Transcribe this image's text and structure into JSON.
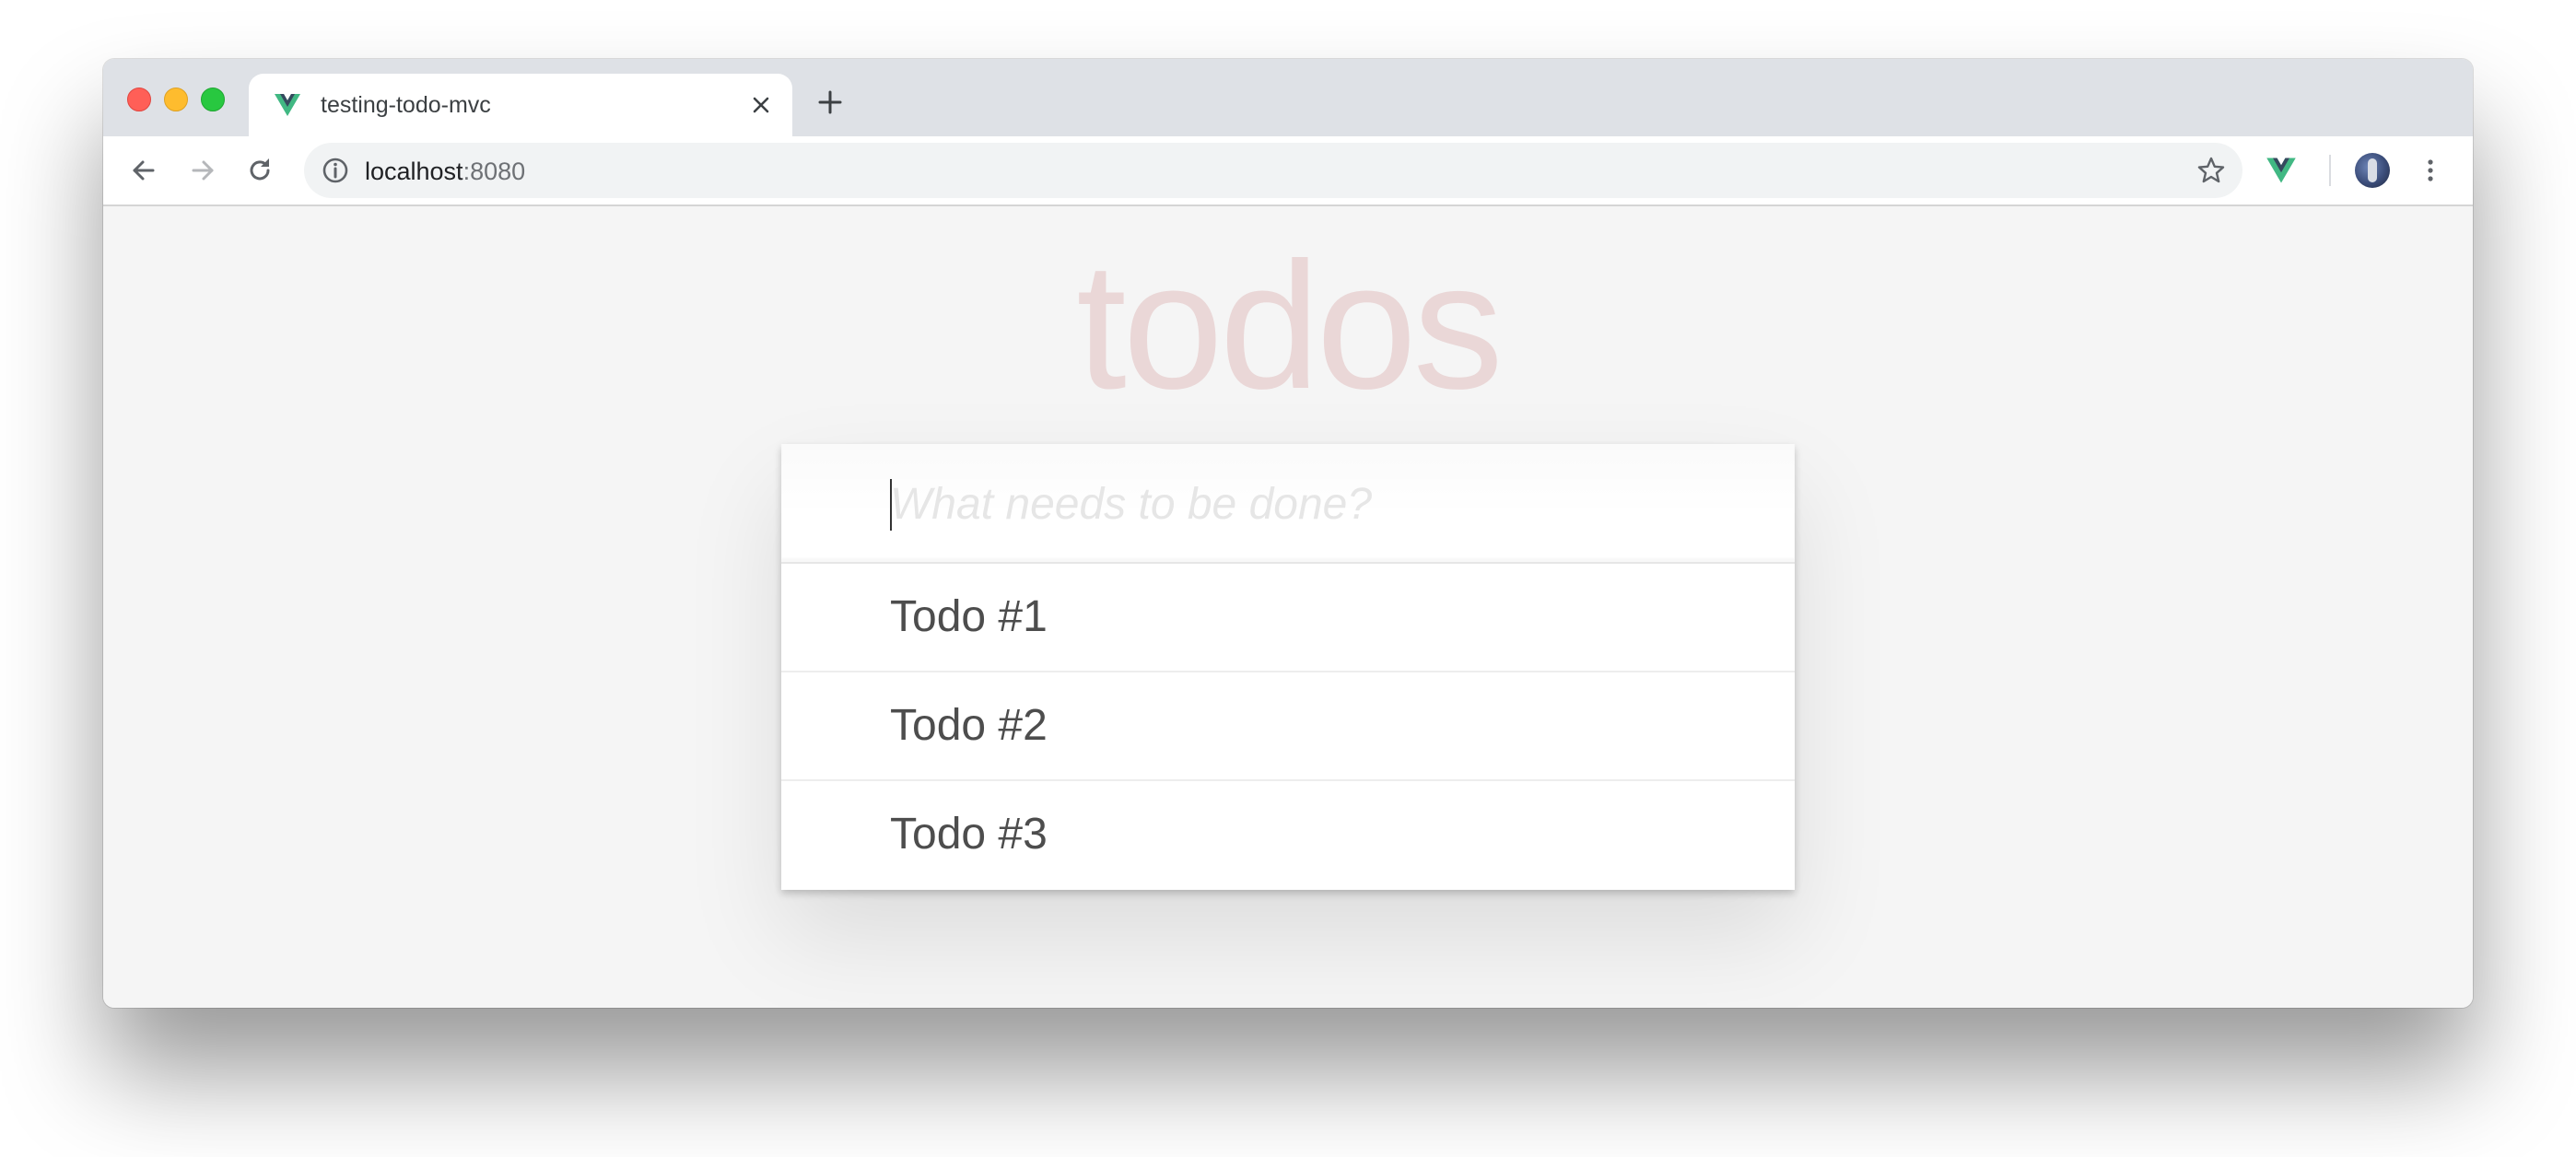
{
  "browser": {
    "tab": {
      "title": "testing-todo-mvc",
      "favicon": "vue-logo-icon"
    },
    "address_bar": {
      "host": "localhost",
      "port": ":8080"
    },
    "toolbar_icons": [
      "back-arrow-icon",
      "forward-arrow-icon",
      "reload-icon",
      "info-icon",
      "star-icon",
      "vue-devtools-icon",
      "avatar",
      "more-menu-icon"
    ]
  },
  "app": {
    "title": "todos",
    "new_todo_placeholder": "What needs to be done?",
    "todos": [
      {
        "label": "Todo #1"
      },
      {
        "label": "Todo #2"
      },
      {
        "label": "Todo #3"
      }
    ]
  },
  "colors": {
    "title": "#af2f2f",
    "page_bg": "#f5f5f5",
    "vue_green": "#41b883",
    "vue_dark": "#35495e"
  }
}
